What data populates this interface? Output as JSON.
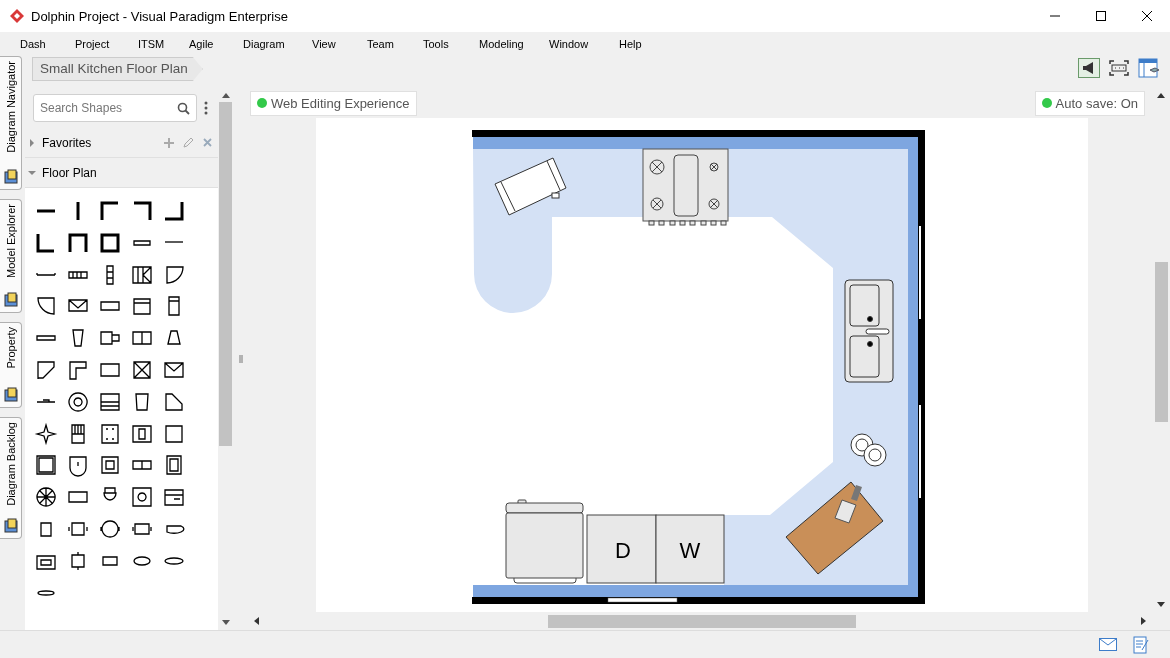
{
  "window": {
    "title": "Dolphin Project - Visual Paradigm Enterprise"
  },
  "menu": [
    "Dash",
    "Project",
    "ITSM",
    "Agile",
    "Diagram",
    "View",
    "Team",
    "Tools",
    "Modeling",
    "Window",
    "Help"
  ],
  "side_tabs": [
    {
      "label": "Diagram Navigator"
    },
    {
      "label": "Model Explorer"
    },
    {
      "label": "Property"
    },
    {
      "label": "Diagram Backlog"
    }
  ],
  "breadcrumb": "Small Kitchen Floor Plan",
  "shapes_panel": {
    "search": {
      "placeholder": "Search Shapes"
    },
    "groups": [
      {
        "label": "Favorites",
        "expanded": false
      },
      {
        "label": "Floor Plan",
        "expanded": true
      }
    ]
  },
  "canvas": {
    "badges": [
      "Web Editing Experience",
      "Auto save: On"
    ],
    "appliance_labels": [
      "D",
      "W"
    ]
  }
}
